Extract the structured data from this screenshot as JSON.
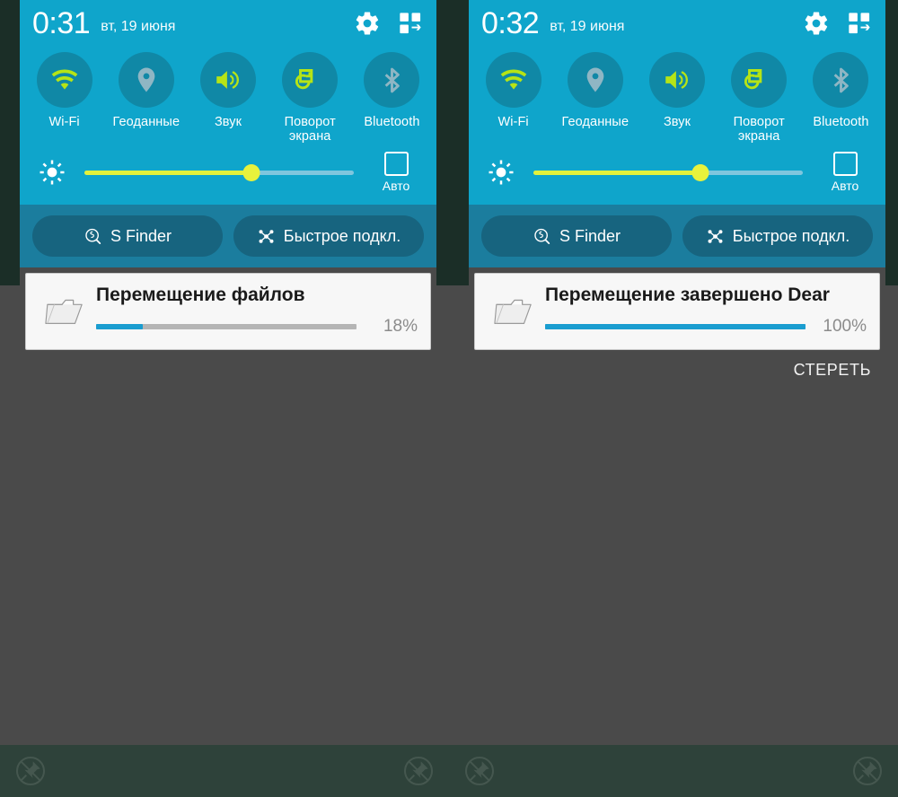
{
  "panels": [
    {
      "id": "left-panel",
      "status": {
        "clock": "0:31",
        "date": "вт, 19 июня",
        "settings_icon": "gear-icon",
        "multiwindow_icon": "multiwindow-icon"
      },
      "toggles": [
        {
          "label": "Wi-Fi",
          "icon": "wifi-icon",
          "active": true
        },
        {
          "label": "Геоданные",
          "icon": "location-pin-icon",
          "active": false
        },
        {
          "label": "Звук",
          "icon": "sound-icon",
          "active": true
        },
        {
          "label": "Поворот\nэкрана",
          "icon": "screen-rotation-icon",
          "active": true
        },
        {
          "label": "Bluetooth",
          "icon": "bluetooth-icon",
          "active": false
        }
      ],
      "brightness": {
        "icon": "brightness-icon",
        "value": 62,
        "auto_label": "Авто",
        "auto_checked": false
      },
      "shortcuts": [
        {
          "label": "S Finder",
          "icon": "search-circle-icon"
        },
        {
          "label": "Быстрое подкл.",
          "icon": "quick-connect-icon"
        }
      ],
      "notification": {
        "icon": "folder-icon",
        "title": "Перемещение файлов",
        "percent": 18,
        "percent_label": "18%"
      },
      "clear_button": null
    },
    {
      "id": "right-panel",
      "status": {
        "clock": "0:32",
        "date": "вт, 19 июня",
        "settings_icon": "gear-icon",
        "multiwindow_icon": "multiwindow-icon"
      },
      "toggles": [
        {
          "label": "Wi-Fi",
          "icon": "wifi-icon",
          "active": true
        },
        {
          "label": "Геоданные",
          "icon": "location-pin-icon",
          "active": false
        },
        {
          "label": "Звук",
          "icon": "sound-icon",
          "active": true
        },
        {
          "label": "Поворот\nэкрана",
          "icon": "screen-rotation-icon",
          "active": true
        },
        {
          "label": "Bluetooth",
          "icon": "bluetooth-icon",
          "active": false
        }
      ],
      "brightness": {
        "icon": "brightness-icon",
        "value": 62,
        "auto_label": "Авто",
        "auto_checked": false
      },
      "shortcuts": [
        {
          "label": "S Finder",
          "icon": "search-circle-icon"
        },
        {
          "label": "Быстрое подкл.",
          "icon": "quick-connect-icon"
        }
      ],
      "notification": {
        "icon": "folder-icon",
        "title": "Перемещение завершено Dear",
        "percent": 100,
        "percent_label": "100%"
      },
      "clear_button": "СТЕРЕТЬ"
    }
  ],
  "navbar": {
    "left_icon": "pin-disabled-icon",
    "right_icon": "pin-disabled-icon"
  },
  "colors": {
    "panel_teal": "#0fa5cb",
    "toggle_circle": "#1088a6",
    "accent_lime": "#b6e416",
    "inactive_icon": "#8fb6c4",
    "finder_strip": "#1b7d9e",
    "pill": "#17647f",
    "progress_blue": "#1a9dd0",
    "progress_track": "#b5b5b5",
    "slider_yellow": "#e2f23c",
    "slider_track": "#7fc6de",
    "background_gray": "#4a4a4a",
    "navbar": "#2e423a",
    "card_bg": "#f7f7f7"
  }
}
